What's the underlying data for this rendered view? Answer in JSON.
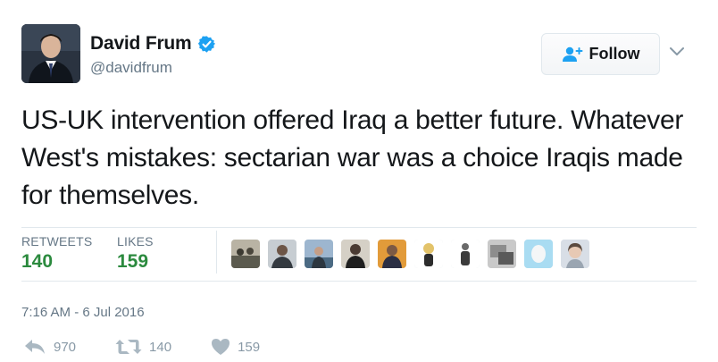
{
  "author": {
    "name": "David Frum",
    "handle": "@davidfrum",
    "verified": true,
    "avatar_icon": "profile-photo"
  },
  "follow_button": {
    "label": "Follow",
    "icon": "add-user-icon"
  },
  "more_menu_icon": "chevron-down-icon",
  "tweet": {
    "text": "US-UK intervention offered Iraq a better future. Whatever West's mistakes: sectarian war was a choice Iraqis made for themselves."
  },
  "stats": {
    "retweets_label": "RETWEETS",
    "retweets_count": "140",
    "likes_label": "LIKES",
    "likes_count": "159"
  },
  "likers_count_shown": 10,
  "timestamp": "7:16 AM - 6 Jul 2016",
  "actions": {
    "reply_count": "970",
    "retweet_count": "140",
    "like_count": "159"
  },
  "colors": {
    "text": "#14171a",
    "muted": "#657786",
    "stat_green": "#2b8a3e",
    "verified_blue": "#1da1f2",
    "action_gray": "#aab8c2"
  }
}
